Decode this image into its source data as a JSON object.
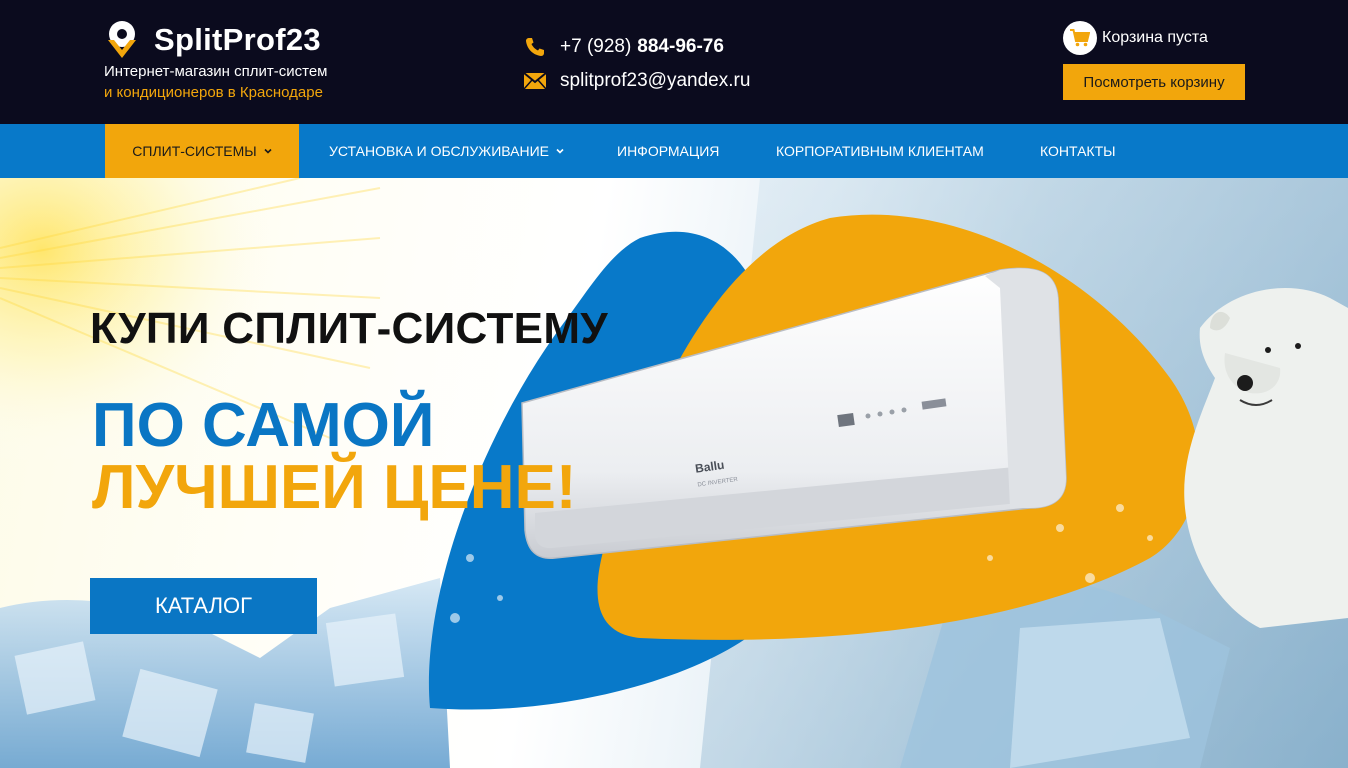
{
  "header": {
    "logo_title": "SplitProf23",
    "logo_line1": "Интернет-магазин сплит-систем",
    "logo_line2": "и кондиционеров в Краснодаре",
    "logo_icon": "location-pin-check-icon",
    "phone_prefix": "+7 (928)",
    "phone_number": "884-96-76",
    "phone_icon": "phone-icon",
    "email": "splitprof23@yandex.ru",
    "email_icon": "envelope-icon",
    "cart_status": "Корзина пуста",
    "cart_icon": "shopping-cart-icon",
    "cart_button": "Посмотреть корзину"
  },
  "nav": {
    "items": [
      {
        "label": "СПЛИТ-СИСТЕМЫ",
        "dropdown": true,
        "active": true
      },
      {
        "label": "УСТАНОВКА И ОБСЛУЖИВАНИЕ",
        "dropdown": true,
        "active": false
      },
      {
        "label": "ИНФОРМАЦИЯ",
        "dropdown": false,
        "active": false
      },
      {
        "label": "КОРПОРАТИВНЫМ КЛИЕНТАМ",
        "dropdown": false,
        "active": false
      },
      {
        "label": "КОНТАКТЫ",
        "dropdown": false,
        "active": false
      }
    ]
  },
  "hero": {
    "title": "КУПИ СПЛИТ-СИСТЕМУ",
    "line_blue": "ПО САМОЙ",
    "line_orange": "ЛУЧШЕЙ ЦЕНЕ!",
    "button": "КАТАЛОГ",
    "product_brand": "Ballu",
    "product_caption": "DC INVERTER"
  },
  "colors": {
    "header_bg": "#0b0b1e",
    "accent_orange": "#f2a60c",
    "accent_blue": "#0879c9"
  }
}
